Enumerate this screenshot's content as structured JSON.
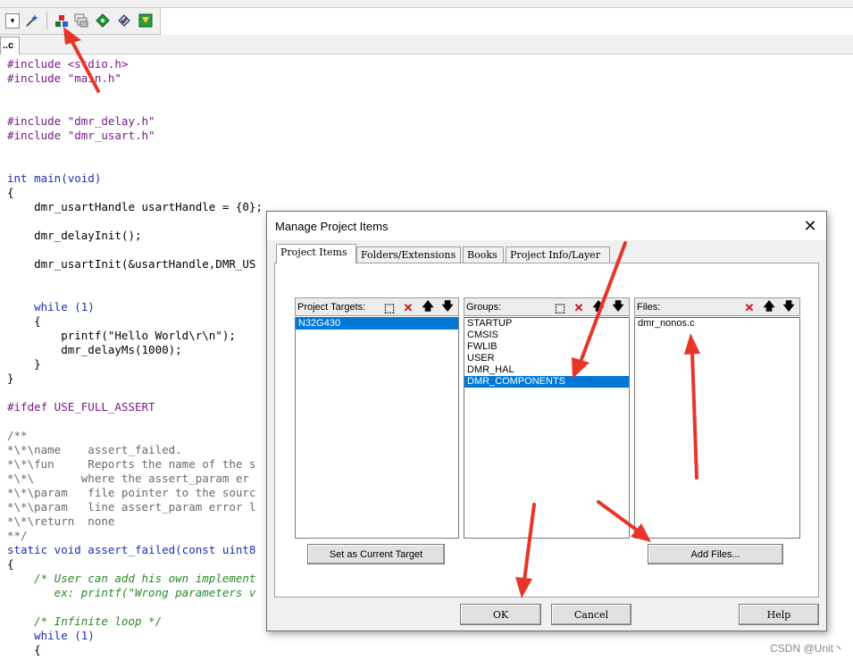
{
  "toolbar": {
    "icons": [
      "dropdown-arrow",
      "magic-wand-icon",
      "manage-project-items-icon",
      "multi-project-icon",
      "green-diamond-icon",
      "diamond-check-icon",
      "pack-installer-icon"
    ],
    "dropdown_glyph": "▾"
  },
  "editor": {
    "tab_label": "..c",
    "lines": [
      "#include <stdio.h>",
      "#include \"main.h\"",
      "",
      "",
      "#include \"dmr_delay.h\"",
      "#include \"dmr_usart.h\"",
      "",
      "",
      "int main(void)",
      "{",
      "    dmr_usartHandle usartHandle = {0};",
      "",
      "    dmr_delayInit();",
      "",
      "    dmr_usartInit(&usartHandle,DMR_US",
      "",
      "",
      "    while (1)",
      "    {",
      "        printf(\"Hello World\\r\\n\");",
      "        dmr_delayMs(1000);",
      "    }",
      "}",
      "",
      "#ifdef USE_FULL_ASSERT",
      "",
      "/**",
      "*\\*\\name    assert_failed.",
      "*\\*\\fun     Reports the name of the s",
      "*\\*\\       where the assert_param er",
      "*\\*\\param   file pointer to the sourc",
      "*\\*\\param   line assert_param error l",
      "*\\*\\return  none",
      "**/",
      "static void assert_failed(const uint8",
      "{",
      "    /* User can add his own implement",
      "       ex: printf(\"Wrong parameters v",
      "",
      "    /* Infinite loop */",
      "    while (1)",
      "    {"
    ]
  },
  "dialog": {
    "title": "Manage Project Items",
    "close_glyph": "✕",
    "tabs": [
      "Project Items",
      "Folders/Extensions",
      "Books",
      "Project Info/Layer"
    ],
    "targets": {
      "label": "Project Targets:",
      "items": [
        "N32G430"
      ],
      "selected": "N32G430"
    },
    "groups": {
      "label": "Groups:",
      "items": [
        "STARTUP",
        "CMSIS",
        "FWLIB",
        "USER",
        "DMR_HAL",
        "DMR_COMPONENTS"
      ],
      "selected": "DMR_COMPONENTS"
    },
    "files": {
      "label": "Files:",
      "items": [
        "dmr_nonos.c"
      ]
    },
    "buttons": {
      "set_current": "Set as Current Target",
      "add_files": "Add Files...",
      "ok": "OK",
      "cancel": "Cancel",
      "help": "Help"
    }
  },
  "watermark": "CSDN @Unit丶",
  "colors": {
    "accent": "#0078d7",
    "arrow": "#e8352a",
    "preprocessor": "#7a1a8a",
    "string": "#8b1414",
    "keyword": "#1c2fb5"
  }
}
